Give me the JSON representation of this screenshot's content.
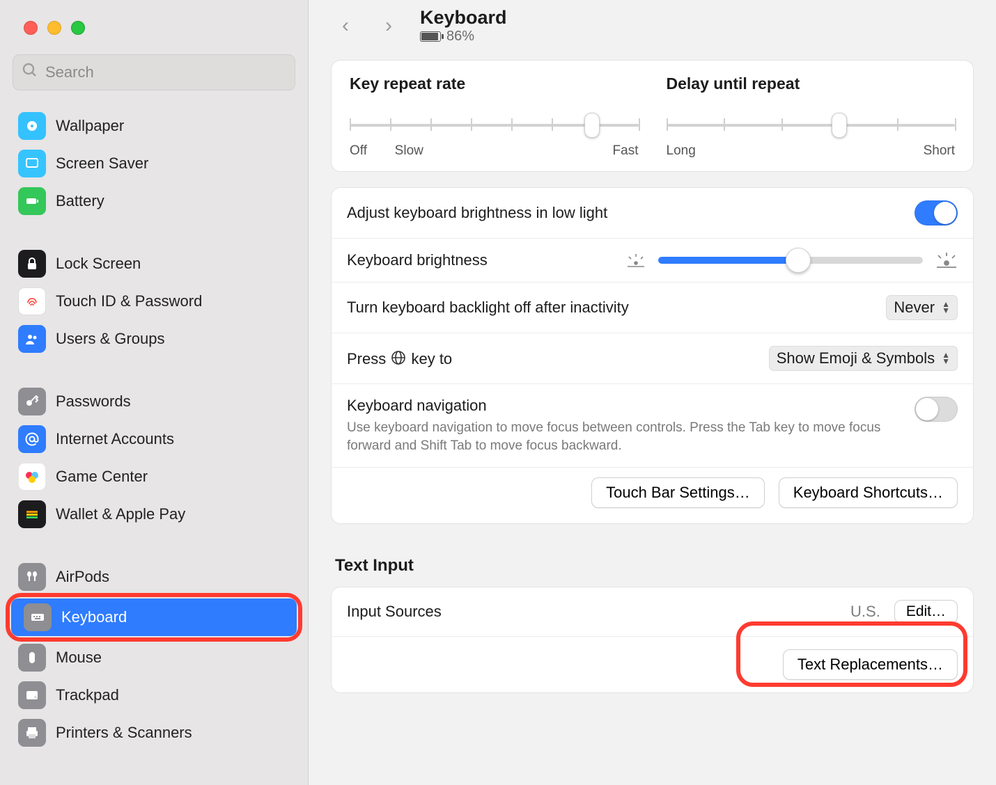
{
  "search": {
    "placeholder": "Search"
  },
  "sidebar": {
    "items": [
      {
        "label": "Wallpaper"
      },
      {
        "label": "Screen Saver"
      },
      {
        "label": "Battery"
      },
      {
        "label": "Lock Screen"
      },
      {
        "label": "Touch ID & Password"
      },
      {
        "label": "Users & Groups"
      },
      {
        "label": "Passwords"
      },
      {
        "label": "Internet Accounts"
      },
      {
        "label": "Game Center"
      },
      {
        "label": "Wallet & Apple Pay"
      },
      {
        "label": "AirPods"
      },
      {
        "label": "Keyboard"
      },
      {
        "label": "Mouse"
      },
      {
        "label": "Trackpad"
      },
      {
        "label": "Printers & Scanners"
      }
    ]
  },
  "header": {
    "title": "Keyboard",
    "battery_pct": "86%"
  },
  "sliders": {
    "repeat_title": "Key repeat rate",
    "repeat_labels": {
      "off": "Off",
      "slow": "Slow",
      "fast": "Fast"
    },
    "delay_title": "Delay until repeat",
    "delay_labels": {
      "long": "Long",
      "short": "Short"
    }
  },
  "rows": {
    "auto_brightness": "Adjust keyboard brightness in low light",
    "brightness": "Keyboard brightness",
    "backlight_off": "Turn keyboard backlight off after inactivity",
    "backlight_value": "Never",
    "globe_pre": "Press ",
    "globe_post": " key to",
    "globe_value": "Show Emoji & Symbols",
    "kb_nav_title": "Keyboard navigation",
    "kb_nav_note": "Use keyboard navigation to move focus between controls. Press the Tab key to move focus forward and Shift Tab to move focus backward."
  },
  "buttons": {
    "touch_bar": "Touch Bar Settings…",
    "shortcuts": "Keyboard Shortcuts…",
    "edit": "Edit…",
    "text_repl": "Text Replacements…"
  },
  "text_input": {
    "section": "Text Input",
    "input_sources": "Input Sources",
    "input_value": "U.S."
  },
  "colors": {
    "accent": "#2f7cff",
    "highlight_ring": "#ff3b30"
  }
}
